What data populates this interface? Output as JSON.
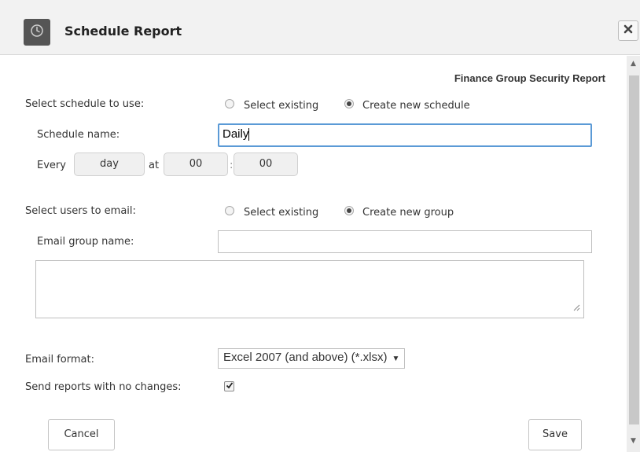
{
  "dialog": {
    "title": "Schedule Report",
    "header_icon": "clock-icon",
    "close_icon": "close-icon"
  },
  "report_name": "Finance Group Security Report",
  "schedule": {
    "label": "Select schedule to use:",
    "option_existing": "Select existing",
    "option_new": "Create new schedule",
    "selected": "Create new schedule",
    "name_label": "Schedule name:",
    "name_value": "Daily",
    "every_label": "Every",
    "period_value": "day",
    "at_label": "at",
    "hour_value": "00",
    "time_separator": ":",
    "minute_value": "00"
  },
  "users": {
    "label": "Select users to email:",
    "option_existing": "Select existing",
    "option_new": "Create new group",
    "selected": "Create new group",
    "group_name_label": "Email group name:",
    "group_name_value": "",
    "email_list_value": ""
  },
  "format": {
    "label": "Email format:",
    "selected": "Excel 2007 (and above) (*.xlsx)"
  },
  "no_changes": {
    "label": "Send reports with no changes:",
    "checked": true
  },
  "buttons": {
    "cancel": "Cancel",
    "save": "Save"
  },
  "colors": {
    "focus_border": "#5b9ad6",
    "header_bg": "#f2f2f2"
  }
}
